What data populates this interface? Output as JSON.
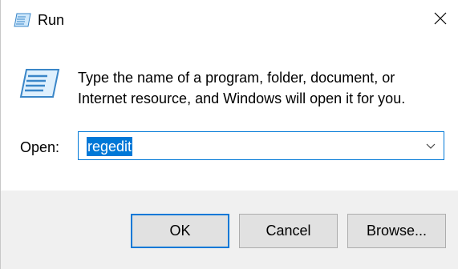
{
  "window": {
    "title": "Run"
  },
  "description": {
    "line1": "Type the name of a program, folder, document, or",
    "line2": "Internet resource, and Windows will open it for you."
  },
  "open_field": {
    "label": "Open:",
    "value": "regedit"
  },
  "buttons": {
    "ok": "OK",
    "cancel": "Cancel",
    "browse": "Browse..."
  },
  "colors": {
    "accent": "#0078d7",
    "footer_bg": "#f0f0f0",
    "button_bg": "#e1e1e1"
  },
  "icons": {
    "title": "run-icon",
    "large": "run-icon",
    "close": "close-icon",
    "dropdown": "chevron-down-icon"
  }
}
